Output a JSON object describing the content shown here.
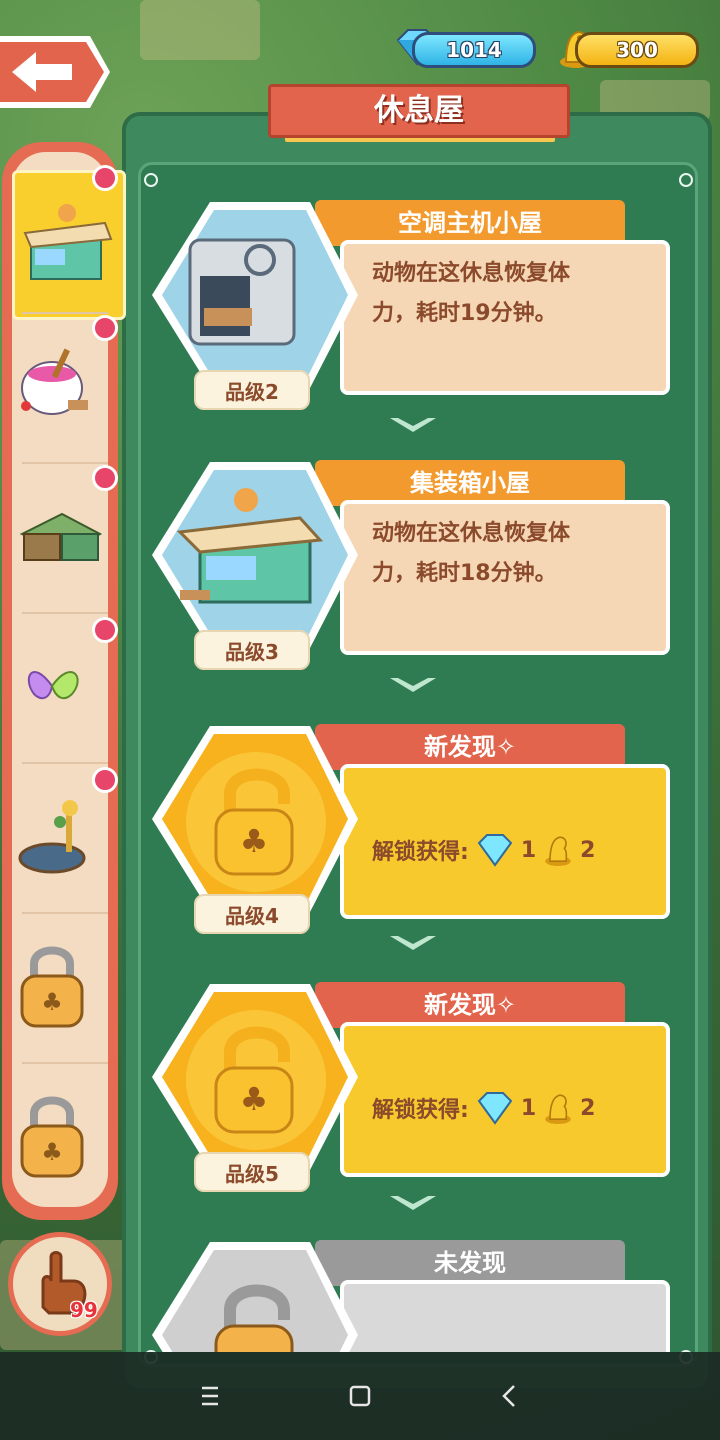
{
  "top_bar": {
    "gems": "1014",
    "coins": "300"
  },
  "panel": {
    "title": "休息屋"
  },
  "sidebar": {
    "items": [
      {
        "name": "container-house",
        "selected": true,
        "new": true
      },
      {
        "name": "bathtub-house",
        "selected": false,
        "new": true
      },
      {
        "name": "log-house",
        "selected": false,
        "new": true
      },
      {
        "name": "butterfly-house",
        "selected": false,
        "new": true
      },
      {
        "name": "pond-house",
        "selected": false,
        "new": true
      },
      {
        "name": "locked-1",
        "selected": false,
        "new": false
      },
      {
        "name": "locked-2",
        "selected": false,
        "new": false
      }
    ],
    "hint_count": "99"
  },
  "cards": [
    {
      "state": "discovered",
      "title": "空调主机小屋",
      "desc_line1": "动物在这休息恢复体",
      "desc_line2": "力，耗时19分钟。",
      "grade": "品级2"
    },
    {
      "state": "discovered",
      "title": "集装箱小屋",
      "desc_line1": "动物在这休息恢复体",
      "desc_line2": "力，耗时18分钟。",
      "grade": "品级3"
    },
    {
      "state": "new",
      "title": "新发现✧",
      "reward_label": "解锁获得:",
      "gem_reward": "1",
      "statue_reward": "2",
      "grade": "品级4"
    },
    {
      "state": "new",
      "title": "新发现✧",
      "reward_label": "解锁获得:",
      "gem_reward": "1",
      "statue_reward": "2",
      "grade": "品级5"
    },
    {
      "state": "undiscovered",
      "title": "未发现"
    }
  ],
  "colors": {
    "panel_green": "#3e8a5e",
    "ribbon_orange": "#f39a2e",
    "ribbon_red": "#e2644c",
    "ribbon_gray": "#9a9a9a",
    "card_beige": "#f6d7b5",
    "card_yellow": "#f8c92d"
  }
}
